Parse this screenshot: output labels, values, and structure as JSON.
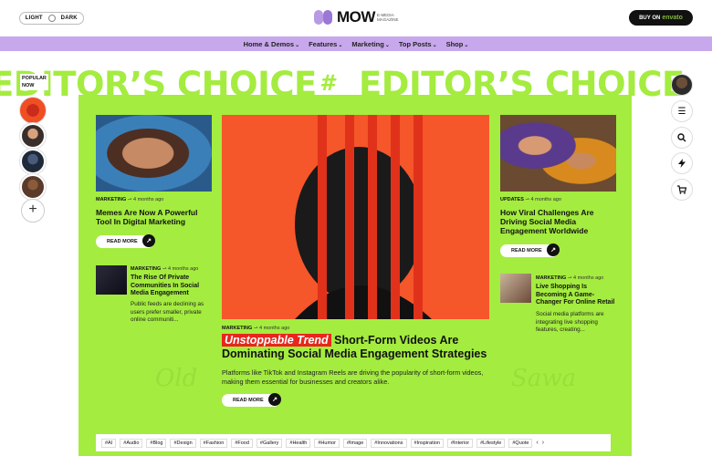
{
  "header": {
    "mode_light": "LIGHT",
    "mode_dark": "DARK",
    "logo_word": "MOW",
    "logo_tagline": "E-MEDIA MAGAZINE",
    "buy_prefix": "BUY ON",
    "buy_brand": "envato"
  },
  "nav": {
    "items": [
      "Home & Demos",
      "Features",
      "Marketing",
      "Top Posts",
      "Shop"
    ]
  },
  "hero": {
    "title_left": "EDITOR’S CHOICE",
    "separator": "#",
    "title_right": "EDITOR’S CHOICE"
  },
  "popular": {
    "label_line1": "POPULAR",
    "label_line2": "NOW",
    "add_label": "+"
  },
  "left_card": {
    "category": "MARKETING",
    "time": "4 months ago",
    "title": "Memes Are Now A Powerful Tool In Digital Marketing",
    "read_more": "READ MORE"
  },
  "left_small": {
    "category": "MARKETING",
    "time": "4 months ago",
    "title": "The Rise Of Private Communities In Social Media Engagement",
    "excerpt": "Public feeds are declining as users prefer smaller, private online communiti..."
  },
  "feature": {
    "category": "MARKETING",
    "time": "4 months ago",
    "badge": "Unstoppable Trend",
    "title": "Short-Form Videos Are Dominating Social Media Engagement Strategies",
    "excerpt": "Platforms like TikTok and Instagram Reels are driving the popularity of short-form videos, making them essential for businesses and creators alike.",
    "read_more": "READ MORE"
  },
  "right_card": {
    "category": "UPDATES",
    "time": "4 months ago",
    "title": "How Viral Challenges Are Driving Social Media Engagement Worldwide",
    "read_more": "READ MORE"
  },
  "right_small": {
    "category": "MARKETING",
    "time": "4 months ago",
    "title": "Live Shopping Is Becoming A Game-Changer For Online Retail",
    "excerpt": "Social media platforms are integrating live shopping features, creating..."
  },
  "tags": [
    "#AI",
    "#Audio",
    "#Blog",
    "#Design",
    "#Fashion",
    "#Food",
    "#Gallery",
    "#Health",
    "#Humor",
    "#Image",
    "#Innovations",
    "#Inspiration",
    "#Interior",
    "#Lifestyle",
    "#Quote"
  ],
  "tag_prev": "‹",
  "tag_next": "›",
  "colors": {
    "accent_green": "#a4ec3f",
    "nav_purple": "#c7a8ec",
    "badge_red": "#e8261d",
    "feature_orange": "#f5562a"
  }
}
